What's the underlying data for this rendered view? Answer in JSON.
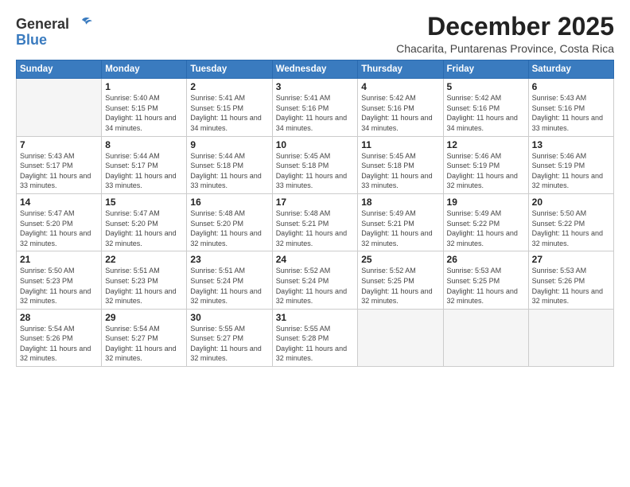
{
  "logo": {
    "general": "General",
    "blue": "Blue"
  },
  "header": {
    "month": "December 2025",
    "location": "Chacarita, Puntarenas Province, Costa Rica"
  },
  "days_of_week": [
    "Sunday",
    "Monday",
    "Tuesday",
    "Wednesday",
    "Thursday",
    "Friday",
    "Saturday"
  ],
  "weeks": [
    [
      {
        "day": "",
        "sunrise": "",
        "sunset": "",
        "daylight": ""
      },
      {
        "day": "1",
        "sunrise": "Sunrise: 5:40 AM",
        "sunset": "Sunset: 5:15 PM",
        "daylight": "Daylight: 11 hours and 34 minutes."
      },
      {
        "day": "2",
        "sunrise": "Sunrise: 5:41 AM",
        "sunset": "Sunset: 5:15 PM",
        "daylight": "Daylight: 11 hours and 34 minutes."
      },
      {
        "day": "3",
        "sunrise": "Sunrise: 5:41 AM",
        "sunset": "Sunset: 5:16 PM",
        "daylight": "Daylight: 11 hours and 34 minutes."
      },
      {
        "day": "4",
        "sunrise": "Sunrise: 5:42 AM",
        "sunset": "Sunset: 5:16 PM",
        "daylight": "Daylight: 11 hours and 34 minutes."
      },
      {
        "day": "5",
        "sunrise": "Sunrise: 5:42 AM",
        "sunset": "Sunset: 5:16 PM",
        "daylight": "Daylight: 11 hours and 34 minutes."
      },
      {
        "day": "6",
        "sunrise": "Sunrise: 5:43 AM",
        "sunset": "Sunset: 5:16 PM",
        "daylight": "Daylight: 11 hours and 33 minutes."
      }
    ],
    [
      {
        "day": "7",
        "sunrise": "Sunrise: 5:43 AM",
        "sunset": "Sunset: 5:17 PM",
        "daylight": "Daylight: 11 hours and 33 minutes."
      },
      {
        "day": "8",
        "sunrise": "Sunrise: 5:44 AM",
        "sunset": "Sunset: 5:17 PM",
        "daylight": "Daylight: 11 hours and 33 minutes."
      },
      {
        "day": "9",
        "sunrise": "Sunrise: 5:44 AM",
        "sunset": "Sunset: 5:18 PM",
        "daylight": "Daylight: 11 hours and 33 minutes."
      },
      {
        "day": "10",
        "sunrise": "Sunrise: 5:45 AM",
        "sunset": "Sunset: 5:18 PM",
        "daylight": "Daylight: 11 hours and 33 minutes."
      },
      {
        "day": "11",
        "sunrise": "Sunrise: 5:45 AM",
        "sunset": "Sunset: 5:18 PM",
        "daylight": "Daylight: 11 hours and 33 minutes."
      },
      {
        "day": "12",
        "sunrise": "Sunrise: 5:46 AM",
        "sunset": "Sunset: 5:19 PM",
        "daylight": "Daylight: 11 hours and 32 minutes."
      },
      {
        "day": "13",
        "sunrise": "Sunrise: 5:46 AM",
        "sunset": "Sunset: 5:19 PM",
        "daylight": "Daylight: 11 hours and 32 minutes."
      }
    ],
    [
      {
        "day": "14",
        "sunrise": "Sunrise: 5:47 AM",
        "sunset": "Sunset: 5:20 PM",
        "daylight": "Daylight: 11 hours and 32 minutes."
      },
      {
        "day": "15",
        "sunrise": "Sunrise: 5:47 AM",
        "sunset": "Sunset: 5:20 PM",
        "daylight": "Daylight: 11 hours and 32 minutes."
      },
      {
        "day": "16",
        "sunrise": "Sunrise: 5:48 AM",
        "sunset": "Sunset: 5:20 PM",
        "daylight": "Daylight: 11 hours and 32 minutes."
      },
      {
        "day": "17",
        "sunrise": "Sunrise: 5:48 AM",
        "sunset": "Sunset: 5:21 PM",
        "daylight": "Daylight: 11 hours and 32 minutes."
      },
      {
        "day": "18",
        "sunrise": "Sunrise: 5:49 AM",
        "sunset": "Sunset: 5:21 PM",
        "daylight": "Daylight: 11 hours and 32 minutes."
      },
      {
        "day": "19",
        "sunrise": "Sunrise: 5:49 AM",
        "sunset": "Sunset: 5:22 PM",
        "daylight": "Daylight: 11 hours and 32 minutes."
      },
      {
        "day": "20",
        "sunrise": "Sunrise: 5:50 AM",
        "sunset": "Sunset: 5:22 PM",
        "daylight": "Daylight: 11 hours and 32 minutes."
      }
    ],
    [
      {
        "day": "21",
        "sunrise": "Sunrise: 5:50 AM",
        "sunset": "Sunset: 5:23 PM",
        "daylight": "Daylight: 11 hours and 32 minutes."
      },
      {
        "day": "22",
        "sunrise": "Sunrise: 5:51 AM",
        "sunset": "Sunset: 5:23 PM",
        "daylight": "Daylight: 11 hours and 32 minutes."
      },
      {
        "day": "23",
        "sunrise": "Sunrise: 5:51 AM",
        "sunset": "Sunset: 5:24 PM",
        "daylight": "Daylight: 11 hours and 32 minutes."
      },
      {
        "day": "24",
        "sunrise": "Sunrise: 5:52 AM",
        "sunset": "Sunset: 5:24 PM",
        "daylight": "Daylight: 11 hours and 32 minutes."
      },
      {
        "day": "25",
        "sunrise": "Sunrise: 5:52 AM",
        "sunset": "Sunset: 5:25 PM",
        "daylight": "Daylight: 11 hours and 32 minutes."
      },
      {
        "day": "26",
        "sunrise": "Sunrise: 5:53 AM",
        "sunset": "Sunset: 5:25 PM",
        "daylight": "Daylight: 11 hours and 32 minutes."
      },
      {
        "day": "27",
        "sunrise": "Sunrise: 5:53 AM",
        "sunset": "Sunset: 5:26 PM",
        "daylight": "Daylight: 11 hours and 32 minutes."
      }
    ],
    [
      {
        "day": "28",
        "sunrise": "Sunrise: 5:54 AM",
        "sunset": "Sunset: 5:26 PM",
        "daylight": "Daylight: 11 hours and 32 minutes."
      },
      {
        "day": "29",
        "sunrise": "Sunrise: 5:54 AM",
        "sunset": "Sunset: 5:27 PM",
        "daylight": "Daylight: 11 hours and 32 minutes."
      },
      {
        "day": "30",
        "sunrise": "Sunrise: 5:55 AM",
        "sunset": "Sunset: 5:27 PM",
        "daylight": "Daylight: 11 hours and 32 minutes."
      },
      {
        "day": "31",
        "sunrise": "Sunrise: 5:55 AM",
        "sunset": "Sunset: 5:28 PM",
        "daylight": "Daylight: 11 hours and 32 minutes."
      },
      {
        "day": "",
        "sunrise": "",
        "sunset": "",
        "daylight": ""
      },
      {
        "day": "",
        "sunrise": "",
        "sunset": "",
        "daylight": ""
      },
      {
        "day": "",
        "sunrise": "",
        "sunset": "",
        "daylight": ""
      }
    ]
  ]
}
